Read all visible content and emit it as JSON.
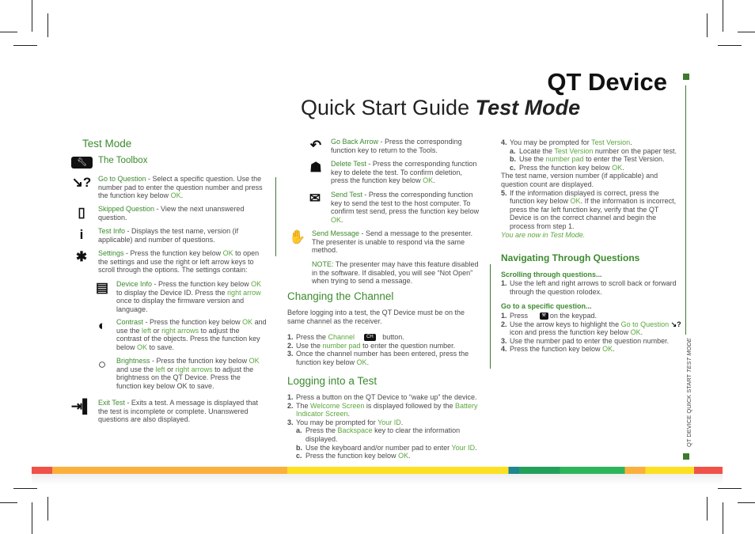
{
  "header": {
    "title": "QT Device",
    "subtitle_plain": "Quick Start Guide ",
    "subtitle_em": "Test Mode"
  },
  "side_label": {
    "plain": "QT DEVICE QUICK START ",
    "em": "TEST MODE"
  },
  "colors": {
    "heading_green": "#3c8a2e",
    "link_green": "#5aa63c",
    "text": "#4a4a4a"
  },
  "col1": {
    "heading": "Test Mode",
    "toolbox": "The Toolbox",
    "items": [
      {
        "icon": "go-to-question-icon",
        "segs": [
          [
            "Go to Question",
            "gb"
          ],
          [
            "  -  Select a specific question. Use the number pad to enter the question number and press the function key below ",
            ""
          ],
          [
            "OK",
            "g"
          ],
          [
            ".",
            ""
          ]
        ]
      },
      {
        "icon": "skipped-question-icon",
        "segs": [
          [
            "Skipped Question",
            "gb"
          ],
          [
            "  -  View the next unanswered question.",
            ""
          ]
        ]
      },
      {
        "icon": "info-icon",
        "segs": [
          [
            "Test Info",
            "gb"
          ],
          [
            "  -  Displays the test name, version (if applicable) and number of questions.",
            ""
          ]
        ]
      },
      {
        "icon": "gear-icon",
        "segs": [
          [
            "Settings",
            "gb"
          ],
          [
            "  -  Press the function key below ",
            ""
          ],
          [
            "OK",
            "g"
          ],
          [
            " to open the settings and use the right or left arrow keys to scroll through the options. The settings contain:",
            ""
          ]
        ]
      },
      {
        "icon": "device-icon",
        "segs": [
          [
            "Device Info",
            "gb"
          ],
          [
            "  -  Press the function key below ",
            ""
          ],
          [
            "OK",
            "g"
          ],
          [
            " to display the Device ID. Press the ",
            ""
          ],
          [
            "right arrow",
            "g"
          ],
          [
            " once to display the firmware version and language.",
            ""
          ]
        ]
      },
      {
        "icon": "contrast-icon",
        "segs": [
          [
            "Contrast",
            "gb"
          ],
          [
            "  -  Press the function key below ",
            ""
          ],
          [
            "OK",
            "g"
          ],
          [
            " and use the ",
            ""
          ],
          [
            "left",
            "g"
          ],
          [
            " or ",
            ""
          ],
          [
            "right arrows",
            "g"
          ],
          [
            " to adjust the contrast of the objects. Press the function key below ",
            ""
          ],
          [
            "OK",
            "g"
          ],
          [
            " to save.",
            ""
          ]
        ]
      },
      {
        "icon": "lightbulb-icon",
        "segs": [
          [
            "Brightness",
            "gb"
          ],
          [
            " -  Press the function key below ",
            ""
          ],
          [
            "OK",
            "g"
          ],
          [
            " and use the ",
            ""
          ],
          [
            "left",
            "g"
          ],
          [
            " or ",
            ""
          ],
          [
            "right arrows",
            "g"
          ],
          [
            " to adjust the brightness on the QT Device. Press the function key below OK to save.",
            ""
          ]
        ]
      },
      {
        "icon": "exit-icon",
        "segs": [
          [
            "Exit Test",
            "gb"
          ],
          [
            "  -  Exits a test. A message is displayed that the test is incomplete or complete. Unanswered questions are also displayed.",
            ""
          ]
        ]
      }
    ]
  },
  "col2": {
    "items": [
      {
        "icon": "back-arrow-icon",
        "segs": [
          [
            "Go Back Arrow",
            "gb"
          ],
          [
            "  -  Press the corresponding function key to return to the Tools.",
            ""
          ]
        ]
      },
      {
        "icon": "trash-icon",
        "segs": [
          [
            "Delete Test",
            "gb"
          ],
          [
            "  -  Press the corresponding function key to delete the test. To confirm deletion, press the function key below ",
            ""
          ],
          [
            "OK",
            "g"
          ],
          [
            ".",
            ""
          ]
        ]
      },
      {
        "icon": "send-icon",
        "segs": [
          [
            "Send Test",
            "gb"
          ],
          [
            " -  Press the corresponding function key to send the test to the host computer. To confirm test send, press the function key below ",
            ""
          ],
          [
            "OK",
            "g"
          ],
          [
            ".",
            ""
          ]
        ]
      },
      {
        "icon": "hand-icon",
        "segs": [
          [
            "Send Message",
            "gb"
          ],
          [
            "  -  Send a message to the presenter. The presenter is unable to respond via the same method.",
            ""
          ]
        ]
      },
      {
        "icon": "",
        "segs": [
          [
            "NOTE:",
            "gb"
          ],
          [
            "  The presenter may have this feature disabled in the software. If disabled, you will see “Not Open” when trying to send a message.",
            ""
          ]
        ]
      }
    ],
    "channel": {
      "heading": "Changing the Channel",
      "intro": "Before logging into a test, the QT Device must be on the same channel as the receiver.",
      "channel_key": "CH",
      "steps": [
        {
          "n": "1.",
          "segs": [
            [
              "Press the ",
              ""
            ],
            [
              "Channel",
              "g"
            ],
            [
              "__KEY__",
              ""
            ],
            [
              " button.",
              ""
            ]
          ]
        },
        {
          "n": "2.",
          "segs": [
            [
              "Use the ",
              ""
            ],
            [
              "number pad",
              "g"
            ],
            [
              " to enter the question number.",
              ""
            ]
          ]
        },
        {
          "n": "3.",
          "segs": [
            [
              "Once the channel number has been entered, press the function key below ",
              ""
            ],
            [
              "OK",
              "g"
            ],
            [
              ".",
              ""
            ]
          ]
        }
      ]
    },
    "login": {
      "heading": "Logging into a Test",
      "steps": [
        {
          "n": "1.",
          "segs": [
            [
              "Press a button on the QT Device to “wake up” the device.",
              ""
            ]
          ]
        },
        {
          "n": "2.",
          "segs": [
            [
              "The ",
              ""
            ],
            [
              "Welcome Screen",
              "g"
            ],
            [
              " is displayed followed by the ",
              ""
            ],
            [
              "Battery Indicator Screen",
              "g"
            ],
            [
              ".",
              ""
            ]
          ]
        },
        {
          "n": "3.",
          "segs": [
            [
              "You may be prompted for ",
              ""
            ],
            [
              "Your ID",
              "g"
            ],
            [
              ".",
              ""
            ]
          ]
        },
        {
          "n": "a.",
          "ind": true,
          "segs": [
            [
              "Press the ",
              ""
            ],
            [
              "Backspace",
              "g"
            ],
            [
              " key to clear the information displayed.",
              ""
            ]
          ]
        },
        {
          "n": "b.",
          "ind": true,
          "segs": [
            [
              "Use the keyboard and/or number pad to enter ",
              ""
            ],
            [
              "Your ID",
              "g"
            ],
            [
              ".",
              ""
            ]
          ]
        },
        {
          "n": "c.",
          "ind": true,
          "segs": [
            [
              "Press the function key below ",
              ""
            ],
            [
              "OK",
              "g"
            ],
            [
              ".",
              ""
            ]
          ]
        }
      ]
    }
  },
  "col3": {
    "steps": [
      {
        "n": "4.",
        "segs": [
          [
            "You may be prompted for ",
            ""
          ],
          [
            "Test Version",
            "g"
          ],
          [
            ".",
            ""
          ]
        ]
      },
      {
        "n": "a.",
        "ind": true,
        "segs": [
          [
            "Locate the ",
            ""
          ],
          [
            "Test Version",
            "g"
          ],
          [
            " number on the paper test.",
            ""
          ]
        ]
      },
      {
        "n": "b.",
        "ind": true,
        "segs": [
          [
            "Use the ",
            ""
          ],
          [
            "number pad",
            "g"
          ],
          [
            " to enter the Test Version.",
            ""
          ]
        ]
      },
      {
        "n": "c.",
        "ind": true,
        "segs": [
          [
            "Press the function key below ",
            ""
          ],
          [
            "OK",
            "g"
          ],
          [
            ".",
            ""
          ]
        ]
      },
      {
        "n": "",
        "segs": [
          [
            "The test name, version number (if applicable) and question count are displayed.",
            ""
          ]
        ]
      },
      {
        "n": "5.",
        "segs": [
          [
            "If the information displayed is correct, press the function key below ",
            ""
          ],
          [
            "OK",
            "g"
          ],
          [
            ". If the information is incorrect, press the far left function key, verify that the QT Device is on the correct channel and begin the process from step 1.",
            ""
          ]
        ]
      },
      {
        "n": "",
        "segs": [
          [
            "You are now in Test Mode.",
            "g it"
          ]
        ]
      }
    ],
    "nav": {
      "heading": "Navigating Through Questions",
      "scroll_sub": "Scrolling through questions...",
      "scroll_steps": [
        {
          "n": "1.",
          "segs": [
            [
              "Use the left and right arrows to scroll back or forward through the question rolodex.",
              ""
            ]
          ]
        }
      ],
      "goto_sub": "Go to a specific question...",
      "goto_steps": [
        {
          "n": "1.",
          "segs": [
            [
              "Press ",
              ""
            ],
            [
              "__WRENCH__",
              ""
            ],
            [
              "on the keypad.",
              ""
            ]
          ]
        },
        {
          "n": "2.",
          "segs": [
            [
              "Use the arrow keys to highlight the ",
              ""
            ],
            [
              "Go to Question",
              "g"
            ],
            [
              " ",
              ""
            ],
            [
              "__GOTO__",
              ""
            ],
            [
              " icon and press the function key below ",
              ""
            ],
            [
              "OK",
              "g"
            ],
            [
              ".",
              ""
            ]
          ]
        },
        {
          "n": "3.",
          "segs": [
            [
              "Use the number pad to enter the question number.",
              ""
            ]
          ]
        },
        {
          "n": "4.",
          "segs": [
            [
              "Press the function key below ",
              ""
            ],
            [
              "OK",
              "g"
            ],
            [
              ".",
              ""
            ]
          ]
        }
      ]
    }
  }
}
